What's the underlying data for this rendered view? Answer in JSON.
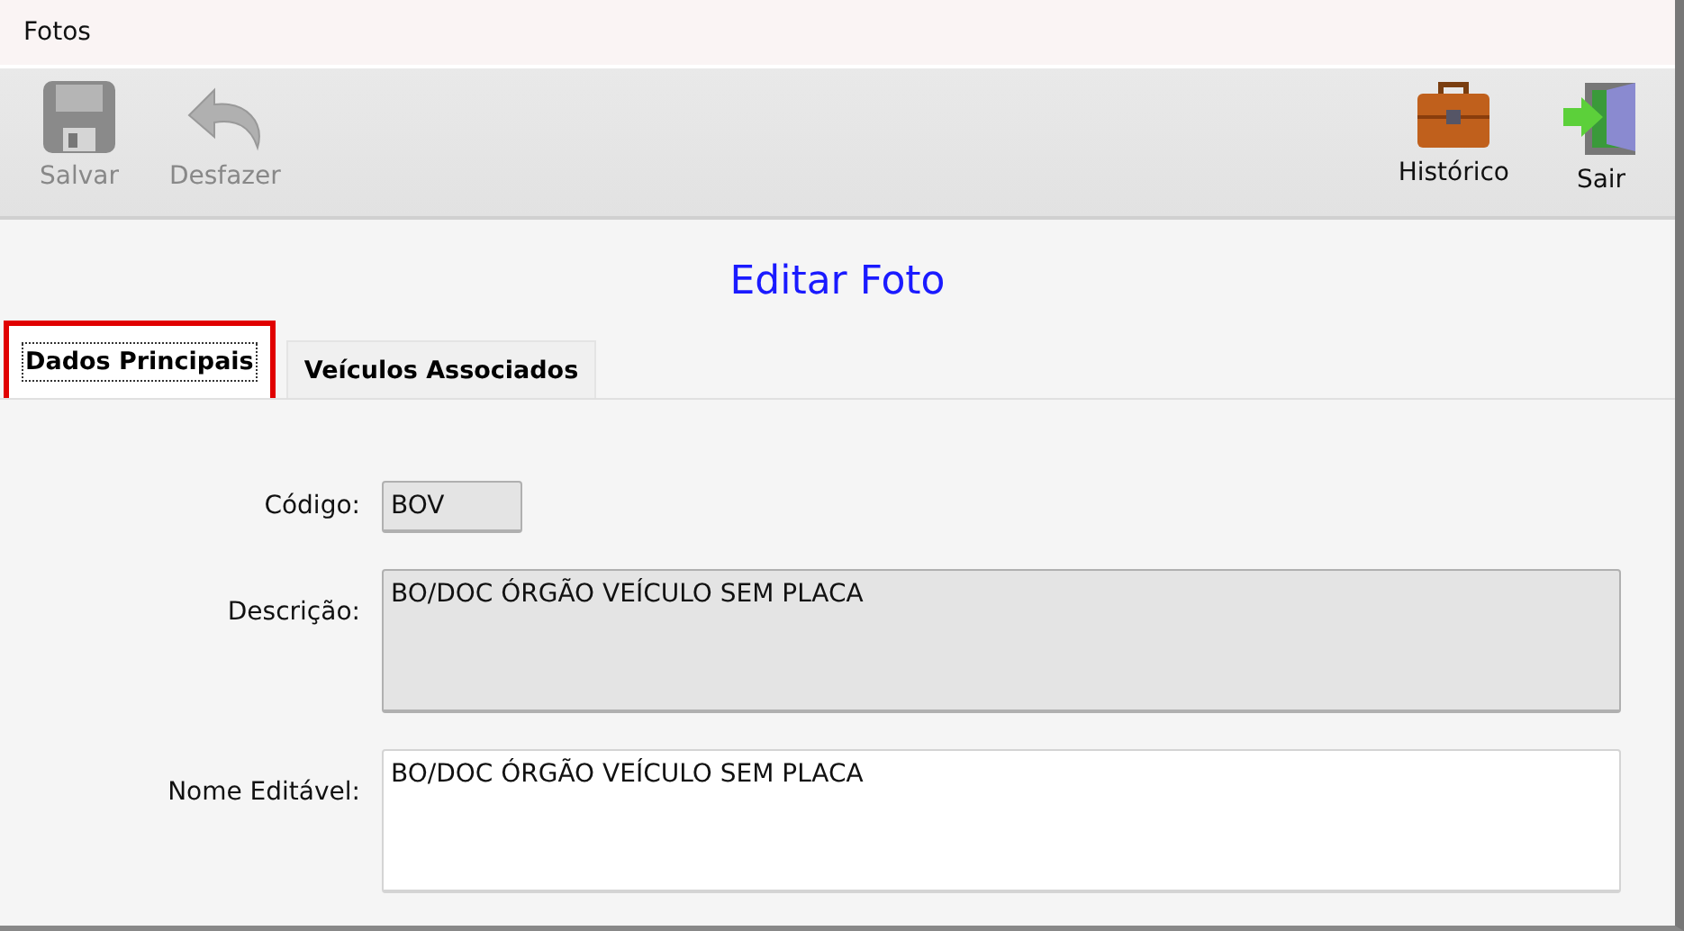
{
  "window": {
    "title": "Fotos"
  },
  "toolbar": {
    "left": [
      {
        "kind": "save",
        "label": "Salvar",
        "disabled": true
      },
      {
        "kind": "undo",
        "label": "Desfazer",
        "disabled": true
      }
    ],
    "right": [
      {
        "kind": "history",
        "label": "Histórico",
        "disabled": false
      },
      {
        "kind": "exit",
        "label": "Sair",
        "disabled": false
      }
    ]
  },
  "heading": "Editar Foto",
  "tabs": [
    {
      "label": "Dados Principais",
      "selected": true,
      "highlighted": true
    },
    {
      "label": "Veículos Associados",
      "selected": false,
      "highlighted": false
    }
  ],
  "fields": [
    {
      "label": "Código:",
      "value": "BOV",
      "kind": "short",
      "disabled": true
    },
    {
      "label": "Descrição:",
      "value": "BO/DOC ÓRGÃO VEÍCULO SEM PLACA",
      "kind": "multiline",
      "disabled": true
    },
    {
      "label": "Nome Editável:",
      "value": "BO/DOC ÓRGÃO VEÍCULO SEM PLACA",
      "kind": "multiline",
      "disabled": false
    }
  ]
}
